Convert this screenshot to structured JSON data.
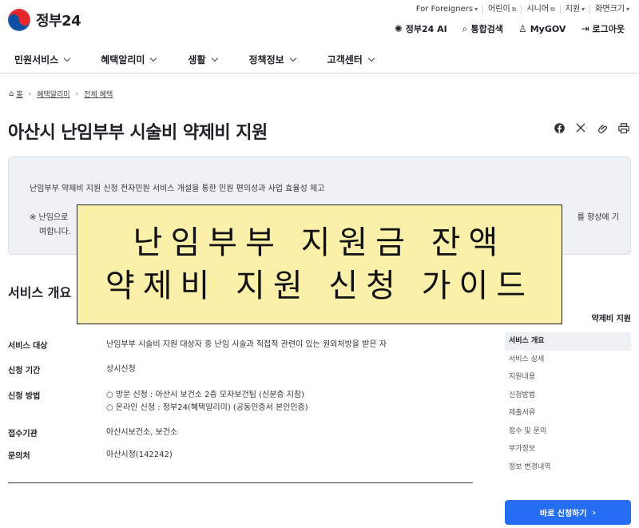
{
  "header": {
    "logo_text": "정부24",
    "utility_links": [
      "For Foreigners",
      "어린이",
      "시니어",
      "지원",
      "화면크기"
    ],
    "actions": [
      {
        "icon": "chatbot-icon",
        "label": "정부24 AI"
      },
      {
        "icon": "search-icon",
        "label": "통합검색"
      },
      {
        "icon": "user-icon",
        "label": "MyGOV"
      },
      {
        "icon": "logout-icon",
        "label": "로그아웃"
      }
    ]
  },
  "gnb": [
    "민원서비스",
    "혜택알리미",
    "생활",
    "정책정보",
    "고객센터"
  ],
  "breadcrumb": {
    "home": "홈",
    "level1": "혜택알리미",
    "level2": "전체 혜택"
  },
  "page_title": "아산시 난임부부 시술비 약제비 지원",
  "summary": {
    "line1": "난임부부 약제비 지원 신청 전자민원 서비스 개설을 통한 민원 편의성과 사업 효율성 제고",
    "line2_start": "※ 난임으로",
    "line2_end": "를 향상에 기",
    "line3": "여합니다."
  },
  "banner": {
    "line1": "난임부부 지원금 잔액",
    "line2": "약제비 지원 신청 가이드"
  },
  "section_title": "서비스 개요",
  "info_rows": [
    {
      "label": "서비스 대상",
      "values": [
        "난임부부 시술비 지원 대상자 중 난임 시술과 직접적 관련이 있는 원외처방을 받은 자"
      ]
    },
    {
      "label": "신청 기간",
      "values": [
        "상시신청"
      ]
    },
    {
      "label": "신청 방법",
      "values": [
        "○ 방문 신청 : 아산시 보건소 2층 모자보건팀 (신분증 지참)",
        "○ 온라인 신청 : 정부24(혜택알리미) (공동인증서 본인인증)"
      ]
    },
    {
      "label": "접수기관",
      "values": [
        "아산시보건소, 보건소"
      ]
    },
    {
      "label": "문의처",
      "values": [
        "아산시청(142242)"
      ]
    }
  ],
  "sidebar": {
    "title": "약제비 지원",
    "items": [
      "서비스 개요",
      "서비스 상세",
      "지원내용",
      "신청방법",
      "제출서류",
      "접수 및 문의",
      "부가정보",
      "정보 변경내역"
    ],
    "active_index": 0,
    "apply_label": "바로 신청하기"
  },
  "colors": {
    "primary": "#256ef4",
    "banner_bg": "#faf0aa",
    "summary_bg": "#eef2f7"
  }
}
